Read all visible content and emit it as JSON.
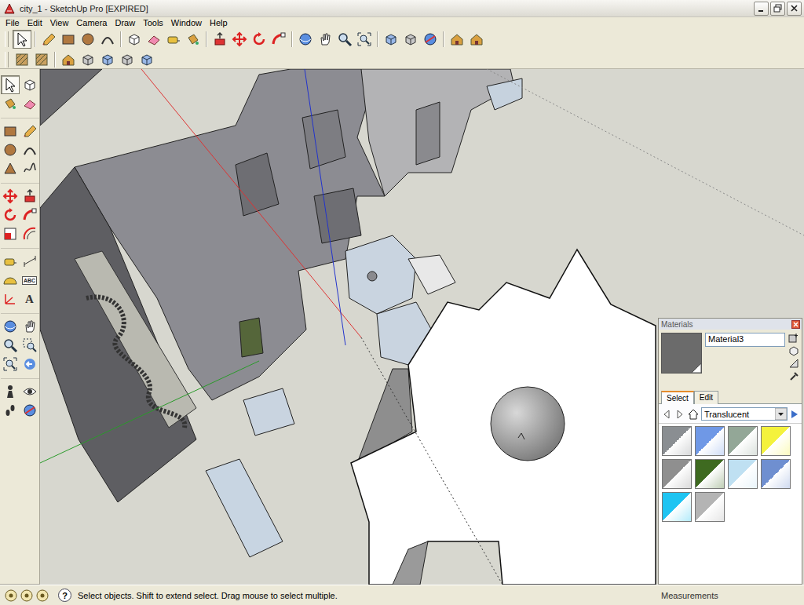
{
  "window": {
    "title": "city_1 - SketchUp Pro [EXPIRED]"
  },
  "menu": [
    "File",
    "Edit",
    "View",
    "Camera",
    "Draw",
    "Tools",
    "Window",
    "Help"
  ],
  "toolbar_rows": [
    [
      {
        "selected": true
      },
      {
        "selected": false
      },
      {
        "selected": false
      },
      {
        "selected": false
      },
      {
        "selected": false
      },
      {
        "selected": false
      },
      {
        "selected": false
      },
      {
        "selected": false
      },
      {
        "selected": false
      },
      {
        "selected": false
      },
      {
        "selected": false
      },
      {
        "selected": false
      },
      {
        "selected": false
      },
      {
        "selected": false
      },
      {
        "selected": false
      },
      {
        "selected": false
      },
      {
        "selected": false
      },
      {
        "selected": false
      },
      {
        "selected": false
      },
      {
        "selected": false
      },
      {
        "selected": false
      },
      {
        "selected": false
      }
    ],
    [
      {
        "selected": false
      },
      {
        "selected": false
      },
      {
        "selected": false
      },
      {
        "selected": false
      },
      {
        "selected": false
      },
      {
        "selected": false
      },
      {
        "selected": false
      }
    ]
  ],
  "left_tools": [
    {
      "selected": true
    },
    {
      "selected": false
    },
    {
      "selected": false
    },
    {
      "selected": false
    },
    {
      "selected": false
    },
    {
      "selected": false
    },
    {
      "selected": false
    },
    {
      "selected": false
    },
    {
      "selected": false
    },
    {
      "selected": false
    },
    {
      "selected": false
    },
    {
      "selected": false
    },
    {
      "selected": false
    },
    {
      "selected": false
    },
    {
      "selected": false
    },
    {
      "selected": false
    },
    {
      "selected": false
    },
    {
      "selected": false
    },
    {
      "selected": false
    },
    {
      "selected": false,
      "glyph": "ABC"
    },
    {
      "selected": false
    },
    {
      "selected": false,
      "glyph": "A"
    },
    {
      "selected": false
    },
    {
      "selected": false
    },
    {
      "selected": false
    },
    {
      "selected": false
    },
    {
      "selected": false
    },
    {
      "selected": false
    },
    {
      "selected": false
    },
    {
      "selected": false
    },
    {
      "selected": false
    },
    {
      "selected": false
    }
  ],
  "materials": {
    "title": "Materials",
    "preview_color": "#6b6b6b",
    "name": "Material3",
    "tabs": [
      {
        "label": "Select",
        "selected": true
      },
      {
        "label": "Edit",
        "selected": false
      }
    ],
    "collection": "Translucent",
    "swatches": [
      {
        "color": "#8a8e92"
      },
      {
        "color": "#6f98e6"
      },
      {
        "color": "#93a797"
      },
      {
        "color": "#f4f23c"
      },
      {
        "color": "#8f8f8f"
      },
      {
        "color": "#3e6a20"
      },
      {
        "color": "#bfe0f2"
      },
      {
        "color": "#6f8fd0"
      },
      {
        "color": "#1ec4f2"
      },
      {
        "color": "#b4b4b4"
      }
    ]
  },
  "status_bar": {
    "help": "?",
    "text": "Select objects. Shift to extend select. Drag mouse to select multiple.",
    "measurements": "Measurements"
  }
}
